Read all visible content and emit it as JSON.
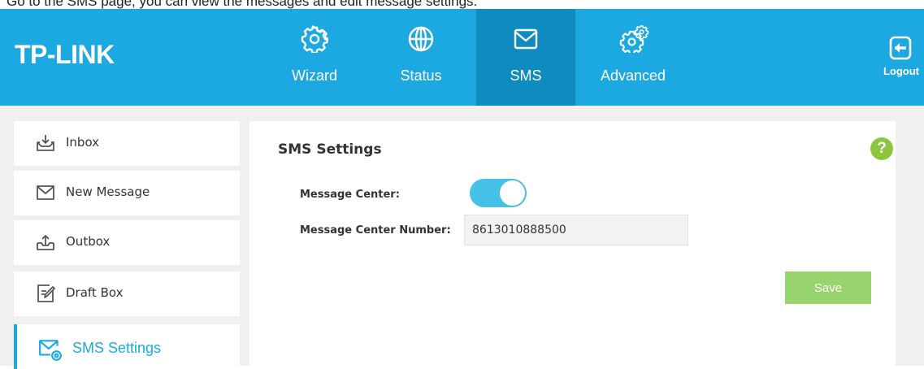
{
  "page_caption": "Go to the SMS page, you can view the messages and edit message settings.",
  "header": {
    "logo": "TP-LINK",
    "nav": [
      {
        "label": "Wizard",
        "icon": "gear-icon"
      },
      {
        "label": "Status",
        "icon": "globe-icon"
      },
      {
        "label": "SMS",
        "icon": "envelope-icon",
        "active": true
      },
      {
        "label": "Advanced",
        "icon": "gears-icon"
      }
    ],
    "logout_label": "Logout"
  },
  "sidebar": {
    "items": [
      {
        "label": "Inbox",
        "icon": "inbox-icon"
      },
      {
        "label": "New Message",
        "icon": "envelope-icon"
      },
      {
        "label": "Outbox",
        "icon": "outbox-icon"
      },
      {
        "label": "Draft Box",
        "icon": "draft-icon"
      },
      {
        "label": "SMS Settings",
        "icon": "sms-settings-icon",
        "active": true
      }
    ]
  },
  "panel": {
    "title": "SMS Settings",
    "help": "?",
    "message_center_label": "Message Center:",
    "message_center_enabled": true,
    "number_label": "Message Center Number:",
    "number_value": "8613010888500",
    "save_label": "Save"
  },
  "colors": {
    "accent": "#1ca9e1",
    "nav_active": "#108bc0",
    "save": "#97d46e",
    "help": "#8cc63e",
    "toggle_on": "#45c0e6"
  }
}
